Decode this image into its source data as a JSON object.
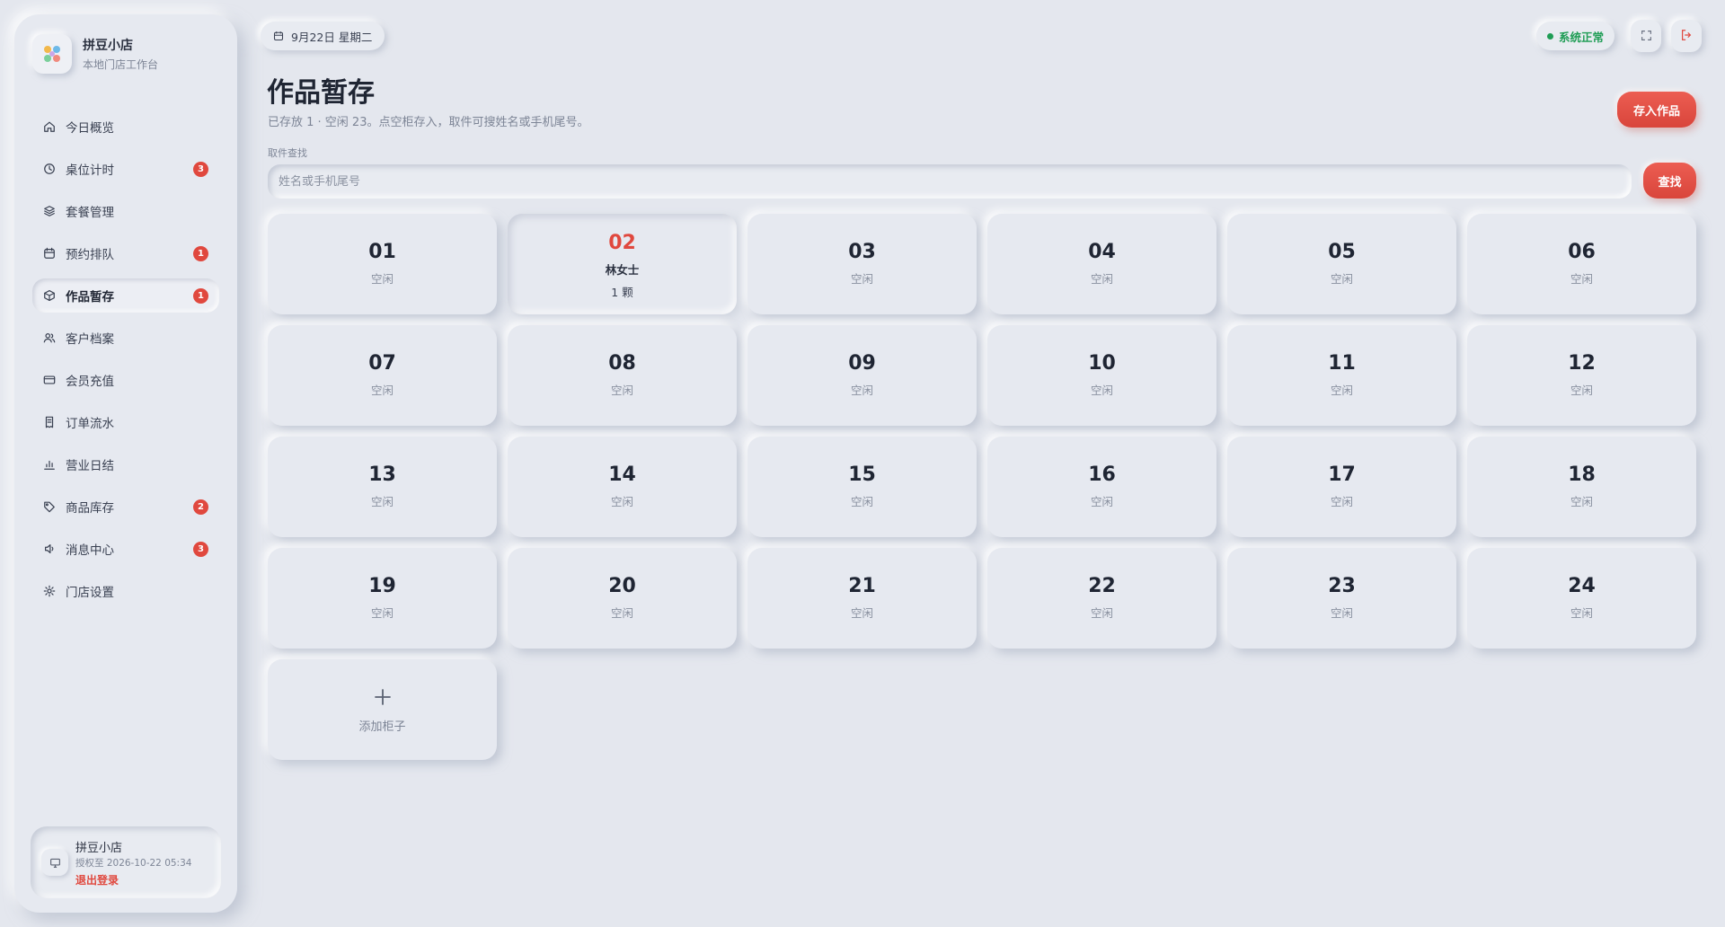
{
  "brand": {
    "name": "拼豆小店",
    "subtitle": "本地门店工作台"
  },
  "nav": [
    {
      "label": "今日概览",
      "icon": "home-icon",
      "badge": ""
    },
    {
      "label": "桌位计时",
      "icon": "clock-icon",
      "badge": "3"
    },
    {
      "label": "套餐管理",
      "icon": "layers-icon",
      "badge": ""
    },
    {
      "label": "预约排队",
      "icon": "calendar-icon",
      "badge": "1"
    },
    {
      "label": "作品暂存",
      "icon": "box-icon",
      "badge": "1",
      "active": true
    },
    {
      "label": "客户档案",
      "icon": "users-icon",
      "badge": ""
    },
    {
      "label": "会员充值",
      "icon": "card-icon",
      "badge": ""
    },
    {
      "label": "订单流水",
      "icon": "receipt-icon",
      "badge": ""
    },
    {
      "label": "营业日结",
      "icon": "bar-chart-icon",
      "badge": ""
    },
    {
      "label": "商品库存",
      "icon": "tag-icon",
      "badge": "2"
    },
    {
      "label": "消息中心",
      "icon": "speaker-icon",
      "badge": "3"
    },
    {
      "label": "门店设置",
      "icon": "gear-icon",
      "badge": ""
    }
  ],
  "user": {
    "name": "拼豆小店",
    "license": "授权至 2026-10-22 05:34",
    "logout": "退出登录"
  },
  "topbar": {
    "date": "9月22日 星期二",
    "status": "系统正常",
    "status_color": "#1f9d55"
  },
  "header": {
    "title": "作品暂存",
    "subtitle": "已存放 1 · 空闲 23。点空柜存入，取件可搜姓名或手机尾号。",
    "store_button": "存入作品"
  },
  "search": {
    "label": "取件查找",
    "placeholder": "姓名或手机尾号",
    "value": "",
    "button": "查找"
  },
  "lockers": [
    {
      "num": "01",
      "status": "空闲"
    },
    {
      "num": "02",
      "owner": "林女士",
      "qty": "1 颗"
    },
    {
      "num": "03",
      "status": "空闲"
    },
    {
      "num": "04",
      "status": "空闲"
    },
    {
      "num": "05",
      "status": "空闲"
    },
    {
      "num": "06",
      "status": "空闲"
    },
    {
      "num": "07",
      "status": "空闲"
    },
    {
      "num": "08",
      "status": "空闲"
    },
    {
      "num": "09",
      "status": "空闲"
    },
    {
      "num": "10",
      "status": "空闲"
    },
    {
      "num": "11",
      "status": "空闲"
    },
    {
      "num": "12",
      "status": "空闲"
    },
    {
      "num": "13",
      "status": "空闲"
    },
    {
      "num": "14",
      "status": "空闲"
    },
    {
      "num": "15",
      "status": "空闲"
    },
    {
      "num": "16",
      "status": "空闲"
    },
    {
      "num": "17",
      "status": "空闲"
    },
    {
      "num": "18",
      "status": "空闲"
    },
    {
      "num": "19",
      "status": "空闲"
    },
    {
      "num": "20",
      "status": "空闲"
    },
    {
      "num": "21",
      "status": "空闲"
    },
    {
      "num": "22",
      "status": "空闲"
    },
    {
      "num": "23",
      "status": "空闲"
    },
    {
      "num": "24",
      "status": "空闲"
    }
  ],
  "add_locker": {
    "icon": "plus-icon",
    "label": "添加柜子"
  },
  "colors": {
    "accent": "#e0483e",
    "background": "#e4e7ee"
  }
}
